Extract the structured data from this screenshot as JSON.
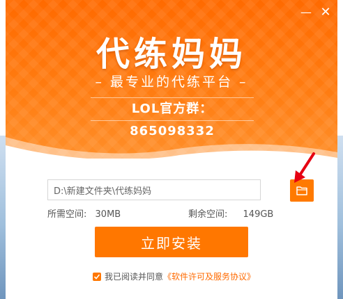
{
  "window": {
    "minimize_glyph": "—",
    "close_glyph": "✕"
  },
  "brand": {
    "logo_text": "代练妈妈",
    "slogan": "– 最专业的代练平台 –",
    "qq_group": "LOL官方群：865098332"
  },
  "install": {
    "path_value": "D:\\新建文件夹\\代练妈妈",
    "required_label": "所需空间:",
    "required_value": "30MB",
    "remaining_label": "剩余空间:",
    "remaining_value": "149GB",
    "button_label": "立即安装",
    "folder_icon": "folder-icon"
  },
  "agreement": {
    "checked": true,
    "prefix": "我已阅读并同意",
    "link_text": "《软件许可及服务协议》"
  },
  "colors": {
    "accent": "#ff7700",
    "header": "#ff6a00",
    "arrow": "#e60012"
  }
}
